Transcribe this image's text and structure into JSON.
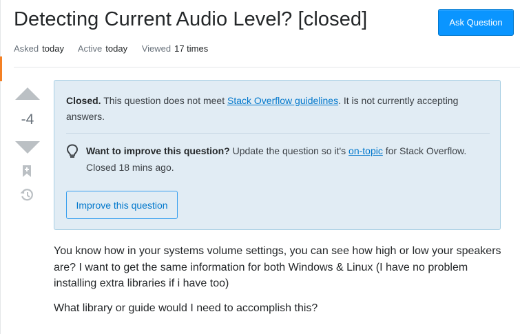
{
  "question": {
    "title": "Detecting Current Audio Level? [closed]",
    "meta": [
      {
        "label": "Asked",
        "value": "today"
      },
      {
        "label": "Active",
        "value": "today"
      },
      {
        "label": "Viewed",
        "value": "17 times"
      }
    ],
    "vote_count": "-4"
  },
  "header": {
    "ask_button_label": "Ask Question"
  },
  "notice": {
    "closed_label": "Closed.",
    "closed_text_1": "This question does not meet",
    "guidelines_link": "Stack Overflow guidelines",
    "closed_text_2": ". It is not currently accepting answers.",
    "improve_label": "Want to improve this question?",
    "improve_text_1": "Update the question so it's",
    "on_topic_link": "on-topic",
    "improve_text_2": "for Stack Overflow.",
    "closed_ago": "Closed 18 mins ago.",
    "improve_button_label": "Improve this question"
  },
  "body": {
    "paragraphs": [
      "You know how in your systems volume settings, you can see how high or low your speakers are? I want to get the same information for both Windows & Linux (I have no problem installing extra libraries if i have too)",
      "What library or guide would I need to accomplish this?"
    ]
  },
  "colors": {
    "accent": "#0a95ff",
    "notice_bg": "#e1ecf4",
    "notice_border": "#a6cee3",
    "link": "#0077cc",
    "rail_accent": "#f48024"
  },
  "icons": [
    "upvote-icon",
    "downvote-icon",
    "bookmark-icon",
    "history-icon",
    "lightbulb-icon"
  ]
}
